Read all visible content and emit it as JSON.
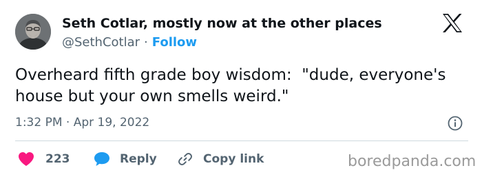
{
  "author": {
    "display_name": "Seth Cotlar, mostly now at the other places",
    "handle": "@SethCotlar",
    "separator": "·",
    "follow_label": "Follow",
    "avatar": "avatar-photo"
  },
  "tweet": {
    "text": "Overheard fifth grade boy wisdom:  \"dude, everyone's house but your own smells weird.\"",
    "timestamp": "1:32 PM · Apr 19, 2022"
  },
  "actions": {
    "like_count": "223",
    "reply_label": "Reply",
    "copy_label": "Copy link"
  },
  "icons": {
    "brand": "x-logo-icon",
    "info": "info-icon",
    "like": "heart-icon",
    "reply": "speech-bubble-icon",
    "copy": "link-icon"
  },
  "colors": {
    "text": "#0f1419",
    "secondary": "#536471",
    "accent": "#1d9bf0",
    "like": "#f91880",
    "divider": "#cfd9de",
    "watermark": "#9a9a9a"
  },
  "watermark": "boredpanda.com"
}
